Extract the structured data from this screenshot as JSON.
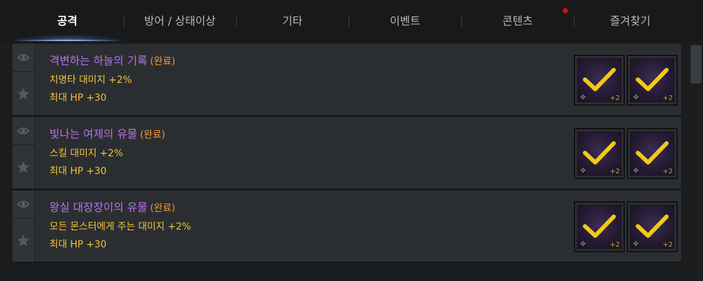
{
  "tabs": [
    {
      "label": "공격",
      "active": true
    },
    {
      "label": "방어 / 상태이상",
      "active": false
    },
    {
      "label": "기타",
      "active": false
    },
    {
      "label": "이벤트",
      "active": false
    },
    {
      "label": "콘텐츠",
      "active": false,
      "has_new": true
    },
    {
      "label": "즐겨찾기",
      "active": false
    }
  ],
  "items": [
    {
      "title": "격변하는 하늘의 기록",
      "status": "(완료)",
      "stats": [
        "치명타 대미지 +2%",
        "최대 HP +30"
      ],
      "cards": [
        {
          "bonus": "+2",
          "checked": true
        },
        {
          "bonus": "+2",
          "checked": true
        }
      ]
    },
    {
      "title": "빛나는 여제의 유물",
      "status": "(완료)",
      "stats": [
        "스킬 대미지 +2%",
        "최대 HP +30"
      ],
      "cards": [
        {
          "bonus": "+2",
          "checked": true
        },
        {
          "bonus": "+2",
          "checked": true
        }
      ]
    },
    {
      "title": "왕실 대장장이의 유물",
      "status": "(완료)",
      "stats": [
        "모든 몬스터에게 주는 대미지 +2%",
        "최대 HP +30"
      ],
      "cards": [
        {
          "bonus": "+2",
          "checked": true
        },
        {
          "bonus": "+2",
          "checked": true
        }
      ]
    }
  ],
  "colors": {
    "title": "#b770f0",
    "status": "#f0963c",
    "stat": "#f0c238",
    "check": "#f2c81c",
    "new_dot": "#c6141a"
  }
}
